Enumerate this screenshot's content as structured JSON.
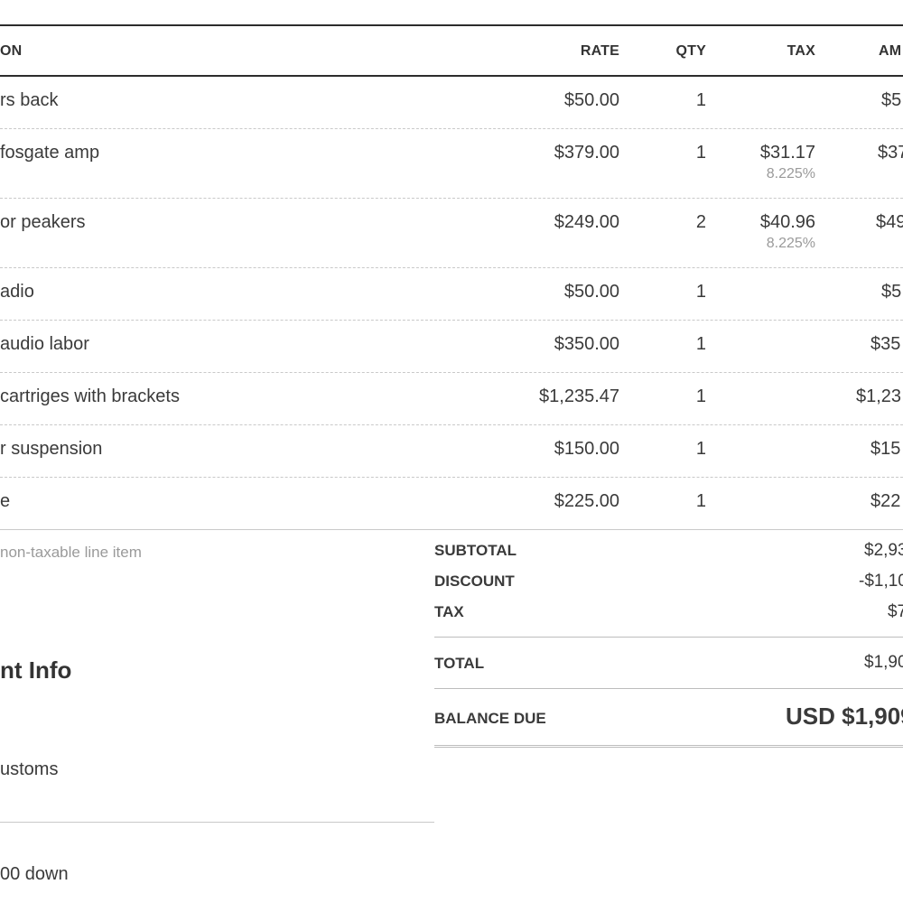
{
  "table": {
    "headers": {
      "description": "ON",
      "rate": "RATE",
      "qty": "QTY",
      "tax": "TAX",
      "amount": "AM"
    },
    "rows": [
      {
        "description": "rs back",
        "rate": "$50.00",
        "qty": "1",
        "tax": "",
        "tax_rate": "",
        "amount": "$5"
      },
      {
        "description": "fosgate amp",
        "rate": "$379.00",
        "qty": "1",
        "tax": "$31.17",
        "tax_rate": "8.225%",
        "amount": "$37"
      },
      {
        "description": "or peakers",
        "rate": "$249.00",
        "qty": "2",
        "tax": "$40.96",
        "tax_rate": "8.225%",
        "amount": "$49"
      },
      {
        "description": "adio",
        "rate": "$50.00",
        "qty": "1",
        "tax": "",
        "tax_rate": "",
        "amount": "$5"
      },
      {
        "description": "audio labor",
        "rate": "$350.00",
        "qty": "1",
        "tax": "",
        "tax_rate": "",
        "amount": "$35"
      },
      {
        "description": "cartriges with brackets",
        "rate": "$1,235.47",
        "qty": "1",
        "tax": "",
        "tax_rate": "",
        "amount": "$1,23"
      },
      {
        "description": "r suspension",
        "rate": "$150.00",
        "qty": "1",
        "tax": "",
        "tax_rate": "",
        "amount": "$15"
      },
      {
        "description": "e",
        "rate": "$225.00",
        "qty": "1",
        "tax": "",
        "tax_rate": "",
        "amount": "$22"
      }
    ]
  },
  "note": "non-taxable line item",
  "summary": {
    "subtotal_label": "SUBTOTAL",
    "subtotal_value": "$2,93",
    "discount_label": "DISCOUNT",
    "discount_value": "-$1,10",
    "tax_label": "TAX",
    "tax_value": "$7",
    "total_label": "TOTAL",
    "total_value": "$1,90",
    "balance_label": "BALANCE DUE",
    "balance_value": "USD $1,909"
  },
  "info": {
    "title": "nt Info",
    "line1": "ustoms",
    "line2": "00 down"
  }
}
